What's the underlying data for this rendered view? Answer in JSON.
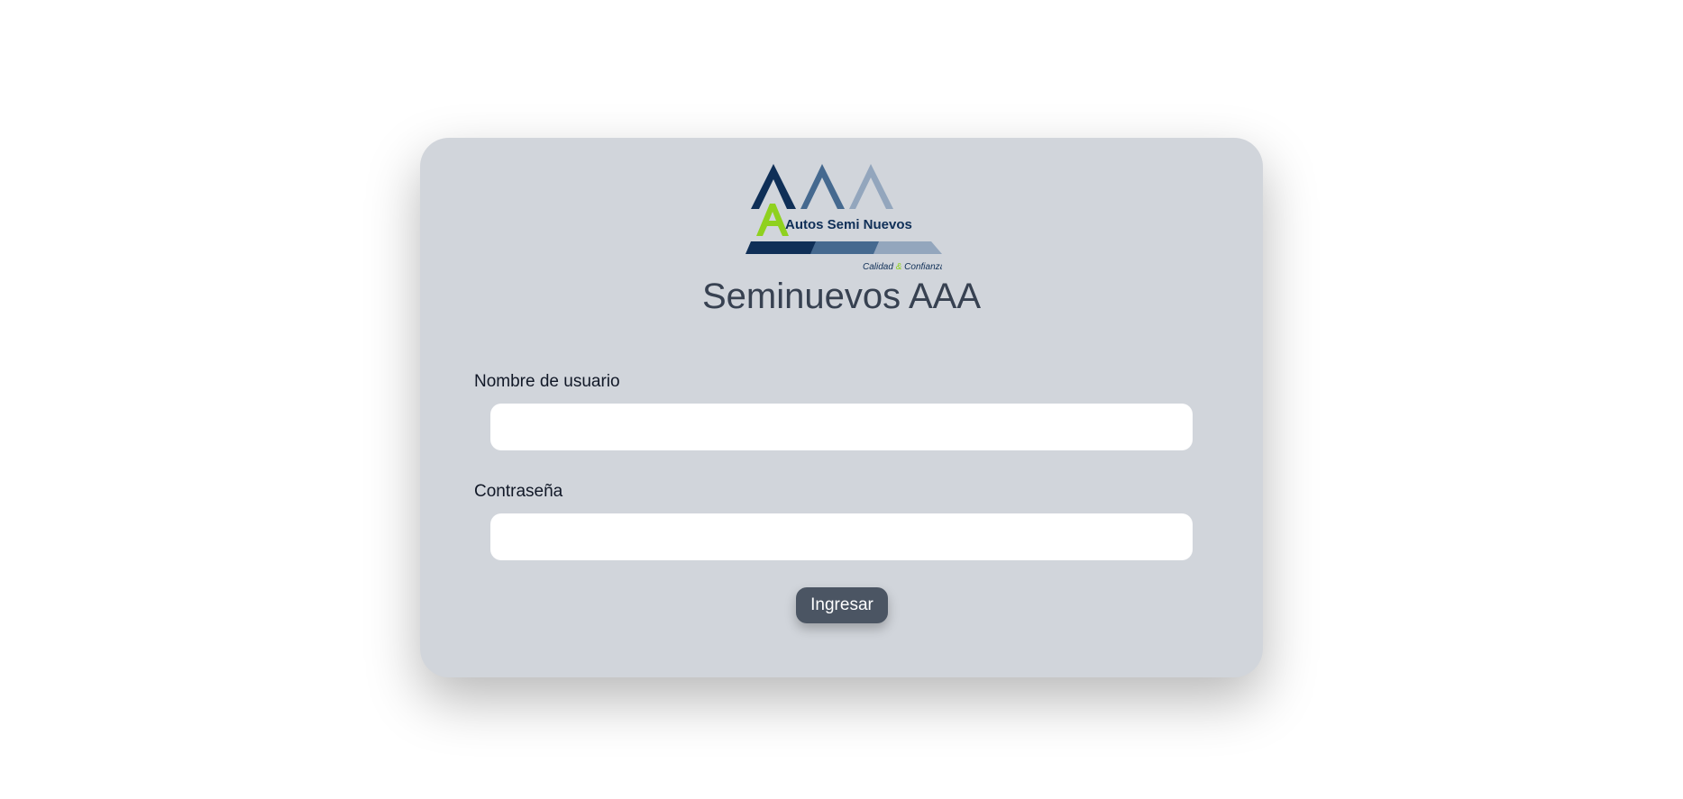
{
  "logo": {
    "brand_text": "Autos Semi Nuevos",
    "tagline_left": "Calidad",
    "tagline_amp": "&",
    "tagline_right": "Confianza"
  },
  "title": "Seminuevos AAA",
  "form": {
    "username_label": "Nombre de usuario",
    "username_value": "",
    "password_label": "Contraseña",
    "password_value": "",
    "submit_label": "Ingresar"
  },
  "colors": {
    "card_bg": "#d1d5db",
    "button_bg": "#4b5563",
    "logo_dark": "#0f2f57",
    "logo_mid": "#45698f",
    "logo_light": "#93a6bd",
    "logo_accent": "#8fd11f"
  }
}
